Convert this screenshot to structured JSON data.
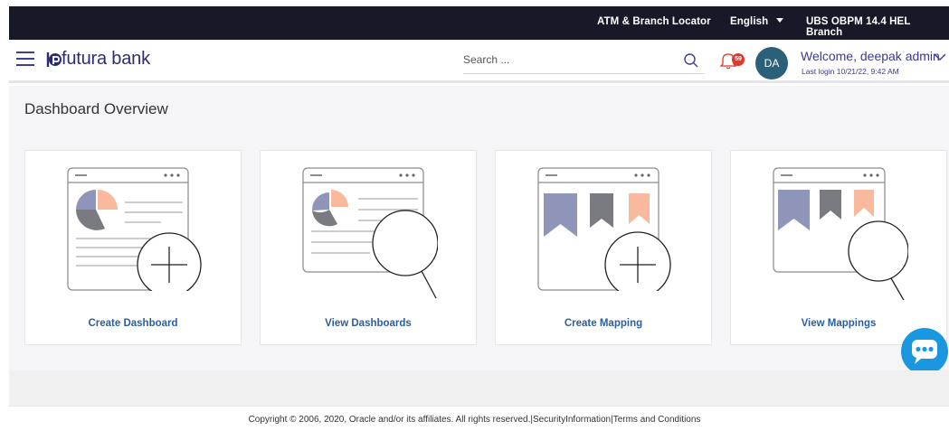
{
  "topbar": {
    "atm_locator": "ATM & Branch Locator",
    "language": "English",
    "branch": "UBS OBPM 14.4 HEL Branch"
  },
  "header": {
    "brand": "futura bank",
    "search_placeholder": "Search ...",
    "notification_count": "59",
    "avatar_initials": "DA",
    "welcome": "Welcome, deepak admin",
    "last_login": "Last login 10/21/22, 9:42 AM"
  },
  "page": {
    "title": "Dashboard Overview"
  },
  "cards": [
    {
      "label": "Create Dashboard",
      "icon": "create-dashboard-icon"
    },
    {
      "label": "View Dashboards",
      "icon": "view-dashboards-icon"
    },
    {
      "label": "Create Mapping",
      "icon": "create-mapping-icon"
    },
    {
      "label": "View Mappings",
      "icon": "view-mappings-icon"
    }
  ],
  "footer": {
    "copyright": "Copyright © 2006, 2020, Oracle and/or its affiliates. All rights reserved.|SecurityInformation|Terms and Conditions"
  },
  "colors": {
    "topbar": "#181928",
    "brand": "#2b2d6e",
    "link": "#2a5f9f",
    "chat": "#1b97e0",
    "badge": "#e0362d",
    "pie_orange": "#f9b99d",
    "pie_purple": "#8e95b8",
    "pie_gray": "#7a7b80"
  }
}
